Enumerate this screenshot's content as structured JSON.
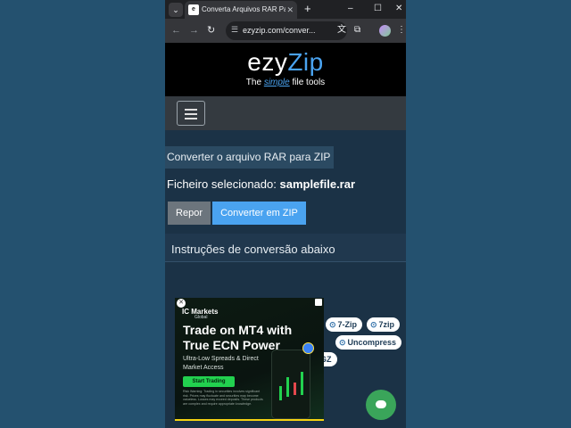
{
  "browser": {
    "tab_title": "Converta Arquivos RAR Para O",
    "favicon_text": "e",
    "url": "ezyzip.com/conver..."
  },
  "site": {
    "logo_ezy": "ezy",
    "logo_zip": "Zip",
    "tagline_the": "The",
    "tagline_simple": "simple",
    "tagline_rest": "file tools"
  },
  "converter": {
    "tab_label": "Converter o arquivo RAR para ZIP",
    "selected_label": "Ficheiro selecionado:",
    "selected_file": "samplefile.rar",
    "reset_button": "Repor",
    "convert_button": "Converter em ZIP",
    "instructions": "Instruções de conversão abaixo"
  },
  "format_pills": {
    "p7zip": "7-Zip",
    "p7z": "7zip",
    "uncompress": "Uncompress",
    "gz": "GZ"
  },
  "ad": {
    "brand": "IC Markets",
    "brand_sub": "Global",
    "headline_1": "Trade on MT4 with",
    "headline_2": "True ECN Power",
    "body_1": "Ultra-Low Spreads & Direct",
    "body_2": "Market Access",
    "cta": "Start Trading",
    "fine_print": "Risk Warning: Trading in securities involves significant risk. Prices may fluctuate and securities may become valueless. Losses may exceed deposits. These products are complex and require appropriate knowledge."
  },
  "icons": [
    "search-tabs-icon",
    "close-icon",
    "new-tab-icon",
    "minimize-icon",
    "maximize-icon",
    "back-icon",
    "forward-icon",
    "reload-icon",
    "site-settings-icon",
    "translate-icon",
    "bookmark-star-icon",
    "extensions-icon",
    "profile-avatar",
    "menu-icon",
    "hamburger-icon",
    "chat-icon"
  ],
  "colors": {
    "page_bg": "#24516f",
    "content_bg": "#1b3246",
    "accent_blue": "#4aa3f0",
    "reset_gray": "#6c757d",
    "chat_green": "#3aa55a"
  }
}
